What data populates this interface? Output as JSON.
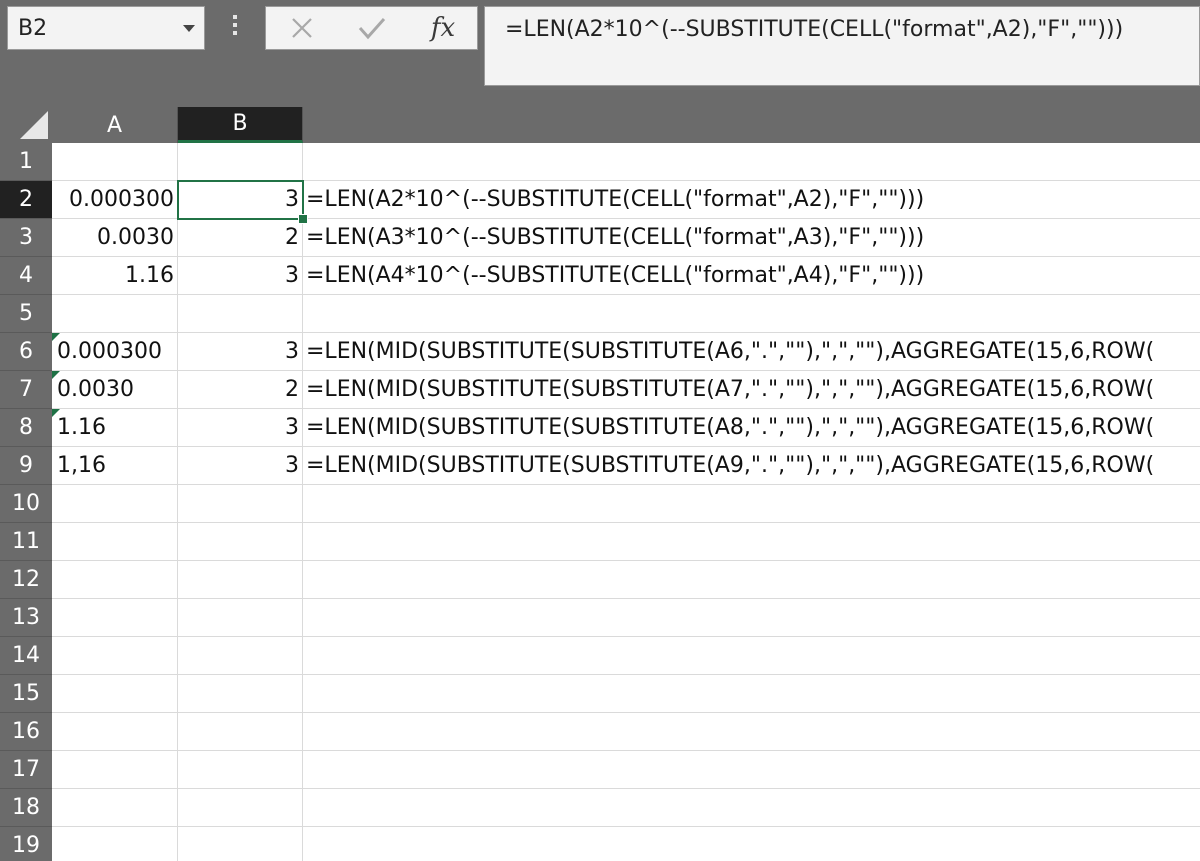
{
  "name_box": {
    "value": "B2"
  },
  "formula_bar": {
    "cancel_icon": "x-icon",
    "enter_icon": "checkmark-icon",
    "fx_label": "fx",
    "formula": "=LEN(A2*10^(--SUBSTITUTE(CELL(\"format\",A2),\"F\",\"\")))"
  },
  "columns": [
    "A",
    "B"
  ],
  "selected_cell": "B2",
  "row_numbers": [
    "1",
    "2",
    "3",
    "4",
    "5",
    "6",
    "7",
    "8",
    "9",
    "10",
    "11",
    "12",
    "13",
    "14",
    "15",
    "16",
    "17",
    "18",
    "19"
  ],
  "rows": [
    {
      "a": "",
      "b": "",
      "f": ""
    },
    {
      "a": "0.000300",
      "b": "3",
      "f": "=LEN(A2*10^(--SUBSTITUTE(CELL(\"format\",A2),\"F\",\"\")))"
    },
    {
      "a": "0.0030",
      "b": "2",
      "f": "=LEN(A3*10^(--SUBSTITUTE(CELL(\"format\",A3),\"F\",\"\")))"
    },
    {
      "a": "1.16",
      "b": "3",
      "f": "=LEN(A4*10^(--SUBSTITUTE(CELL(\"format\",A4),\"F\",\"\")))"
    },
    {
      "a": "",
      "b": "",
      "f": ""
    },
    {
      "a": "0.000300",
      "b": "3",
      "f": "=LEN(MID(SUBSTITUTE(SUBSTITUTE(A6,\".\",\"\"),\",\",\"\"),AGGREGATE(15,6,ROW("
    },
    {
      "a": "0.0030",
      "b": "2",
      "f": "=LEN(MID(SUBSTITUTE(SUBSTITUTE(A7,\".\",\"\"),\",\",\"\"),AGGREGATE(15,6,ROW("
    },
    {
      "a": "1.16",
      "b": "3",
      "f": "=LEN(MID(SUBSTITUTE(SUBSTITUTE(A8,\".\",\"\"),\",\",\"\"),AGGREGATE(15,6,ROW("
    },
    {
      "a": "1,16",
      "b": "3",
      "f": "=LEN(MID(SUBSTITUTE(SUBSTITUTE(A9,\".\",\"\"),\",\",\"\"),AGGREGATE(15,6,ROW("
    }
  ],
  "colors": {
    "selection": "#217346",
    "header_bg": "#6b6b6b",
    "header_selected_bg": "#212121",
    "text_flag": "#1e7145"
  }
}
